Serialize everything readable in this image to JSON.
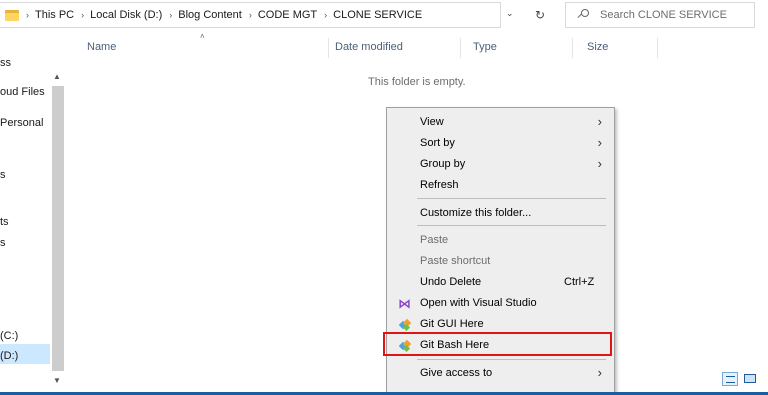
{
  "address_bar": {
    "crumbs": [
      "This PC",
      "Local Disk (D:)",
      "Blog Content",
      "CODE MGT",
      "CLONE SERVICE"
    ],
    "dropdown_glyph": "⌄",
    "refresh_glyph": "↻"
  },
  "search": {
    "placeholder": "Search CLONE SERVICE",
    "value": ""
  },
  "nav_pane": {
    "items": [
      "ss",
      "oud Files",
      "Personal",
      "s",
      "ts",
      "s",
      "(C:)",
      "(D:)"
    ],
    "selected": "(D:)"
  },
  "columns": {
    "name": "Name",
    "date_modified": "Date modified",
    "type": "Type",
    "size": "Size"
  },
  "empty_message": "This folder is empty.",
  "context_menu": {
    "view": "View",
    "sort_by": "Sort by",
    "group_by": "Group by",
    "refresh": "Refresh",
    "customize": "Customize this folder...",
    "paste": "Paste",
    "paste_shortcut": "Paste shortcut",
    "undo_delete": "Undo Delete",
    "undo_shortcut": "Ctrl+Z",
    "open_vs": "Open with Visual Studio",
    "git_gui": "Git GUI Here",
    "git_bash": "Git Bash Here",
    "give_access": "Give access to",
    "submenu_glyph": "›"
  },
  "colors": {
    "highlight_box": "#e01414",
    "menu_background": "#eeeeee",
    "selected_nav": "#cce8ff",
    "header_text": "#4c607a"
  }
}
